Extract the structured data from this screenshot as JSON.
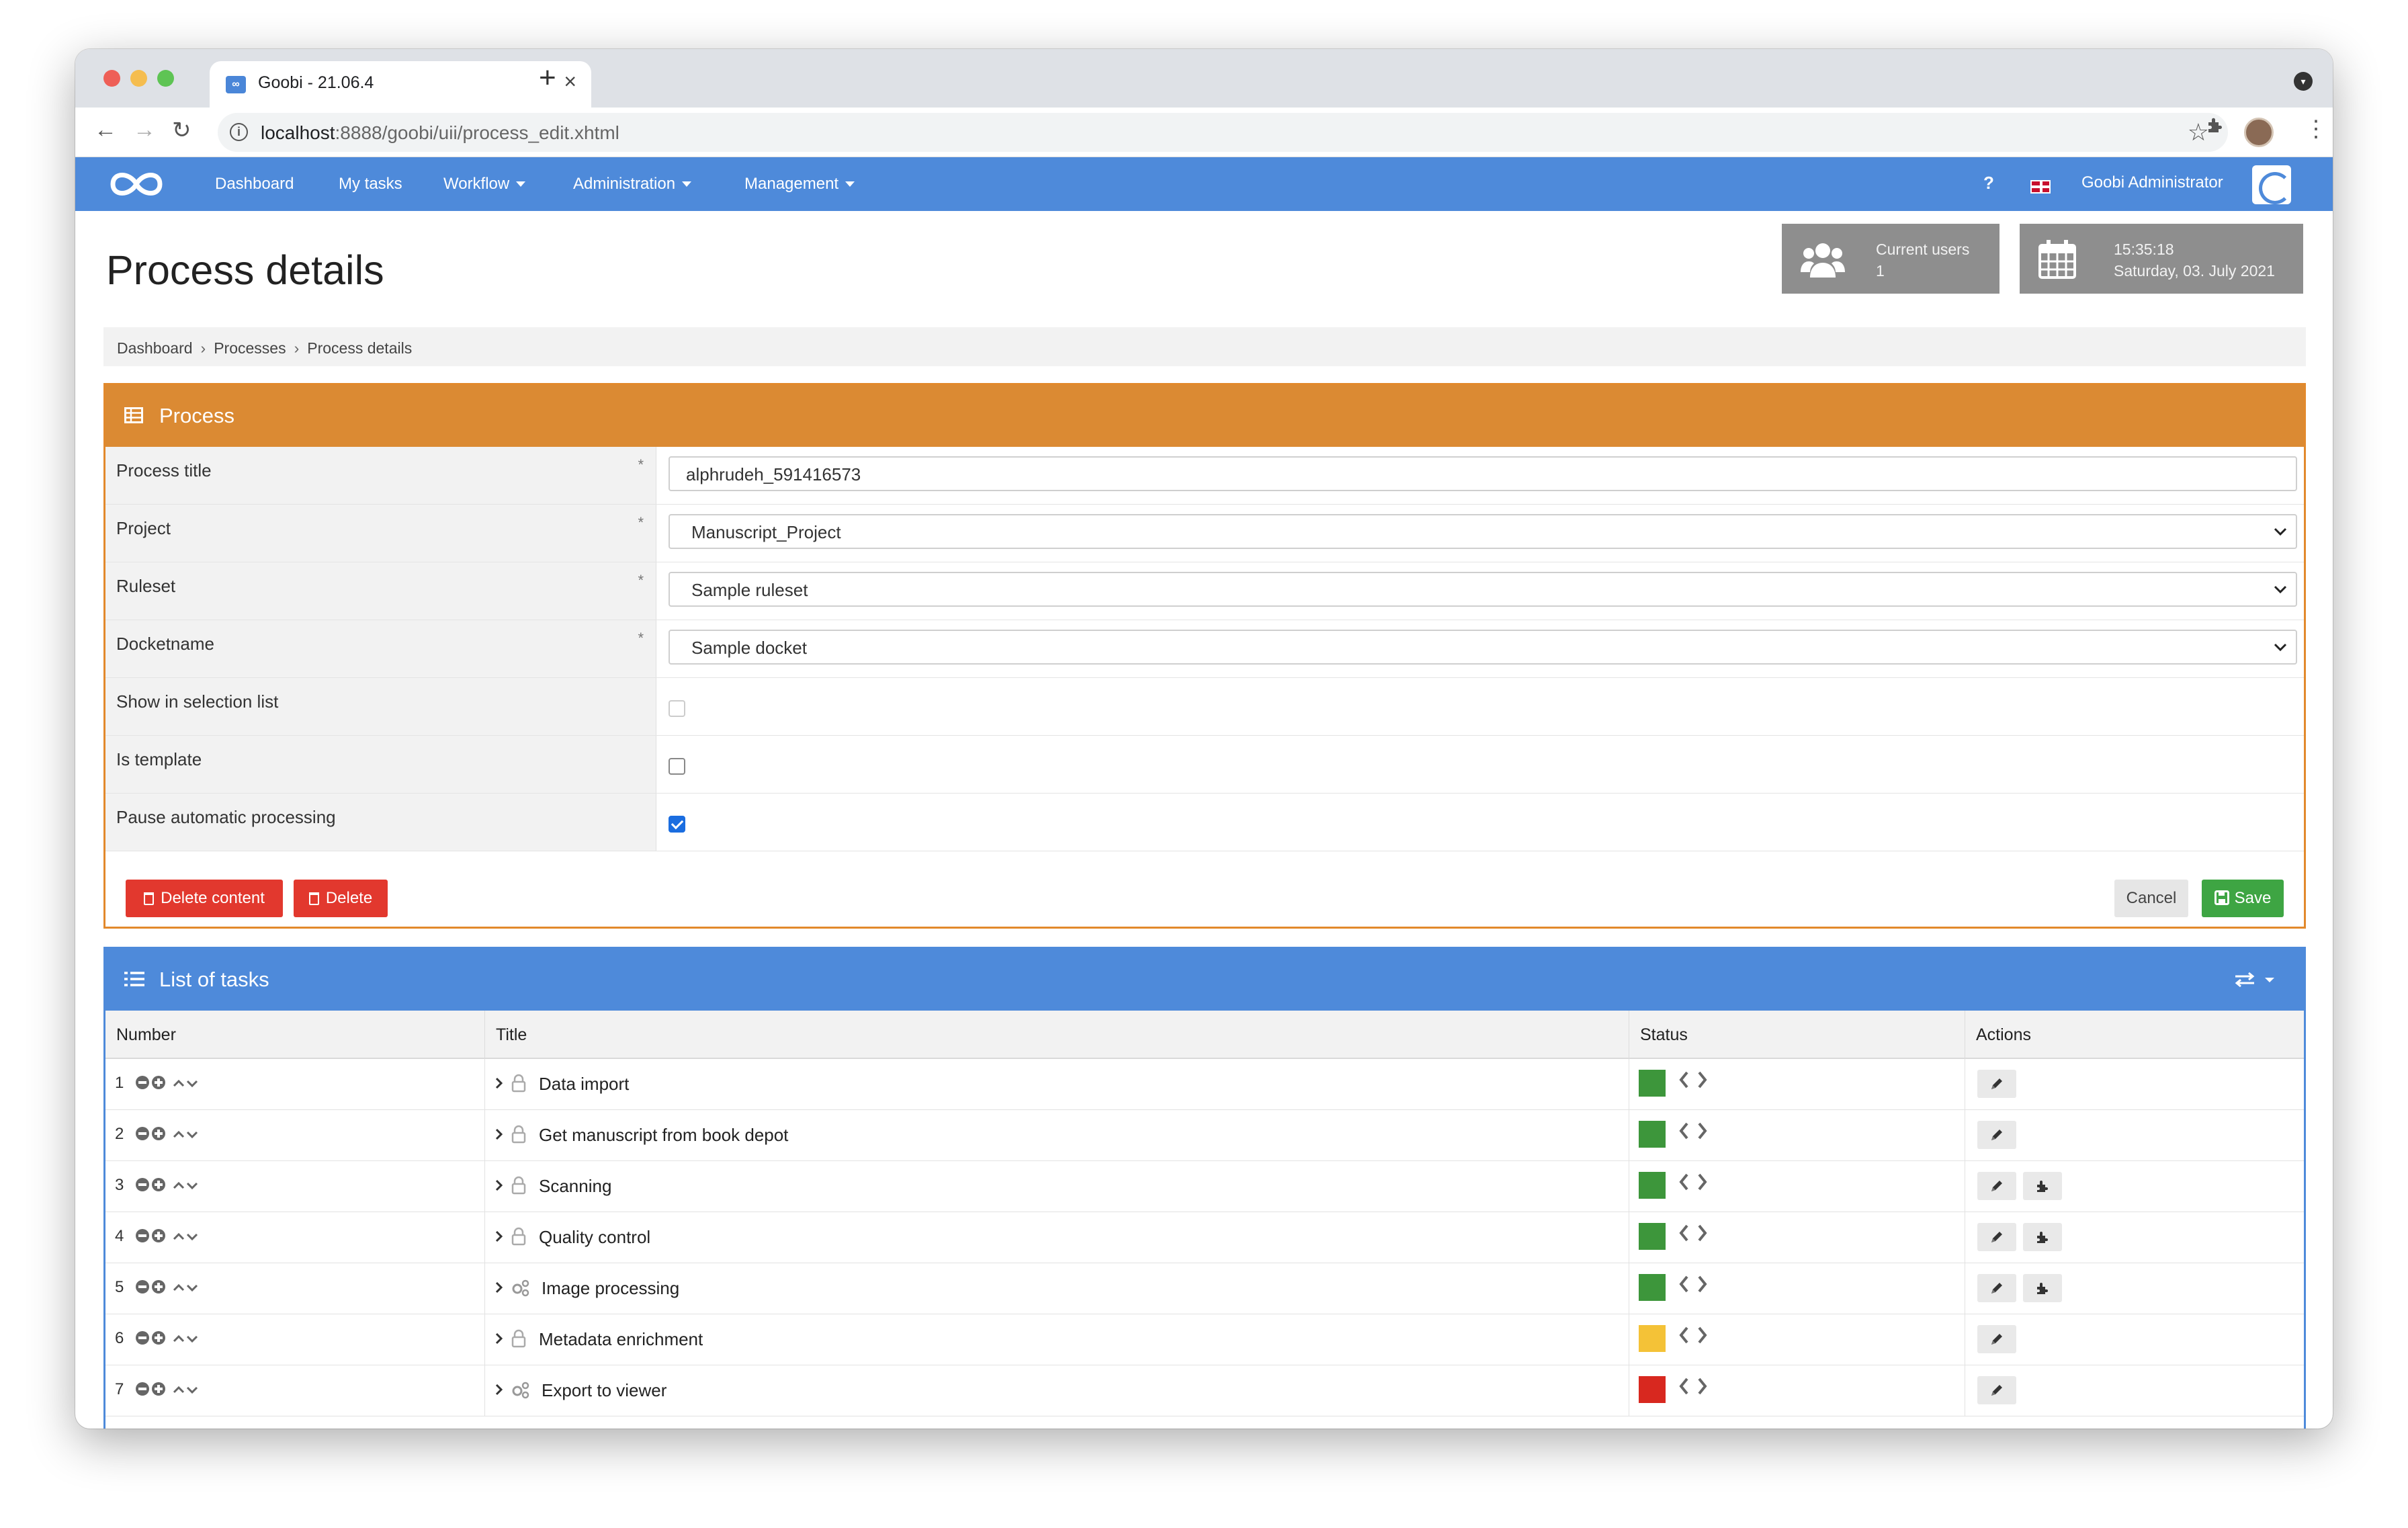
{
  "browser": {
    "tab_title": "Goobi - 21.06.4",
    "url_host": "localhost",
    "url_path": ":8888/goobi/uii/process_edit.xhtml"
  },
  "nav": {
    "items": [
      "Dashboard",
      "My tasks",
      "Workflow",
      "Administration",
      "Management"
    ],
    "help": "?",
    "user": "Goobi Administrator"
  },
  "page": {
    "title": "Process details",
    "current_users_label": "Current users",
    "current_users_count": "1",
    "time": "15:35:18",
    "date": "Saturday, 03. July 2021"
  },
  "breadcrumb": [
    "Dashboard",
    "Processes",
    "Process details"
  ],
  "process": {
    "header": "Process",
    "fields": {
      "process_title_label": "Process title",
      "process_title_value": "alphrudeh_591416573",
      "project_label": "Project",
      "project_value": "Manuscript_Project",
      "ruleset_label": "Ruleset",
      "ruleset_value": "Sample ruleset",
      "docketname_label": "Docketname",
      "docketname_value": "Sample docket",
      "show_in_selection_label": "Show in selection list",
      "is_template_label": "Is template",
      "pause_label": "Pause automatic processing",
      "required_mark": "*"
    },
    "checkboxes": {
      "show_in_selection": false,
      "is_template": false,
      "pause_automatic": true
    },
    "buttons": {
      "delete_content": "Delete content",
      "delete": "Delete",
      "cancel": "Cancel",
      "save": "Save"
    }
  },
  "tasks": {
    "header": "List of tasks",
    "columns": {
      "number": "Number",
      "title": "Title",
      "status": "Status",
      "actions": "Actions"
    },
    "rows": [
      {
        "number": "1",
        "title": "Data import",
        "icon": "lock-icon",
        "status_color": "#3d963b",
        "plugin": false
      },
      {
        "number": "2",
        "title": "Get manuscript from book depot",
        "icon": "lock-icon",
        "status_color": "#3d963b",
        "plugin": false
      },
      {
        "number": "3",
        "title": "Scanning",
        "icon": "lock-icon",
        "status_color": "#3d963b",
        "plugin": true
      },
      {
        "number": "4",
        "title": "Quality control",
        "icon": "lock-icon",
        "status_color": "#3d963b",
        "plugin": true
      },
      {
        "number": "5",
        "title": "Image processing",
        "icon": "cogs-icon",
        "status_color": "#3d963b",
        "plugin": true
      },
      {
        "number": "6",
        "title": "Metadata enrichment",
        "icon": "lock-icon",
        "status_color": "#f4c237",
        "plugin": false
      },
      {
        "number": "7",
        "title": "Export to viewer",
        "icon": "cogs-icon",
        "status_color": "#d8281f",
        "plugin": false
      }
    ]
  },
  "colors": {
    "nav": "#4e8ada",
    "process_panel": "#db8a33",
    "danger": "#e2382e",
    "success": "#3ea543"
  }
}
